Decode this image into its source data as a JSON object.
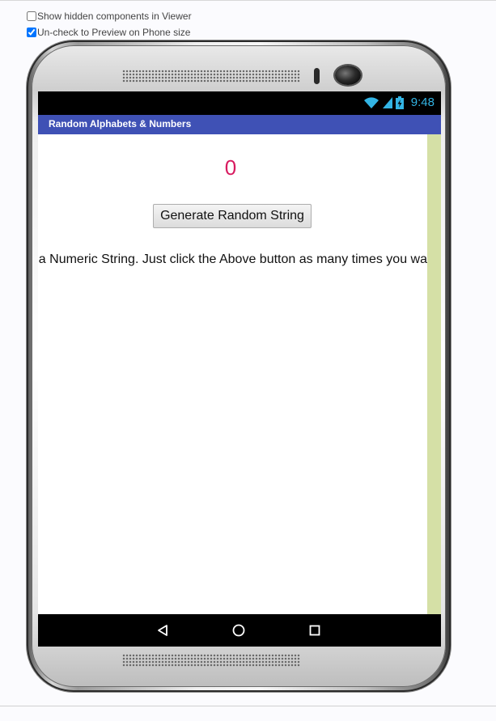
{
  "viewer_options": {
    "show_hidden": {
      "label": "Show hidden components in Viewer",
      "checked": false
    },
    "preview_phone": {
      "label": "Un-check to Preview on Phone size",
      "checked": true
    }
  },
  "status_bar": {
    "time": "9:48",
    "icons": [
      "wifi-icon",
      "signal-icon",
      "battery-charging-icon"
    ]
  },
  "app": {
    "title": "Random Alphabets & Numbers",
    "counter": "0",
    "button_label": "Generate Random String",
    "description": "ha Numeric String. Just click the Above button as many times you wa"
  },
  "nav_bar": {
    "icons": [
      "back-icon",
      "home-icon",
      "recents-icon"
    ]
  },
  "colors": {
    "title_bar": "#3f51b5",
    "counter": "#d81b60",
    "status_time": "#33b5e5",
    "side_strip": "#d5e0a6"
  }
}
